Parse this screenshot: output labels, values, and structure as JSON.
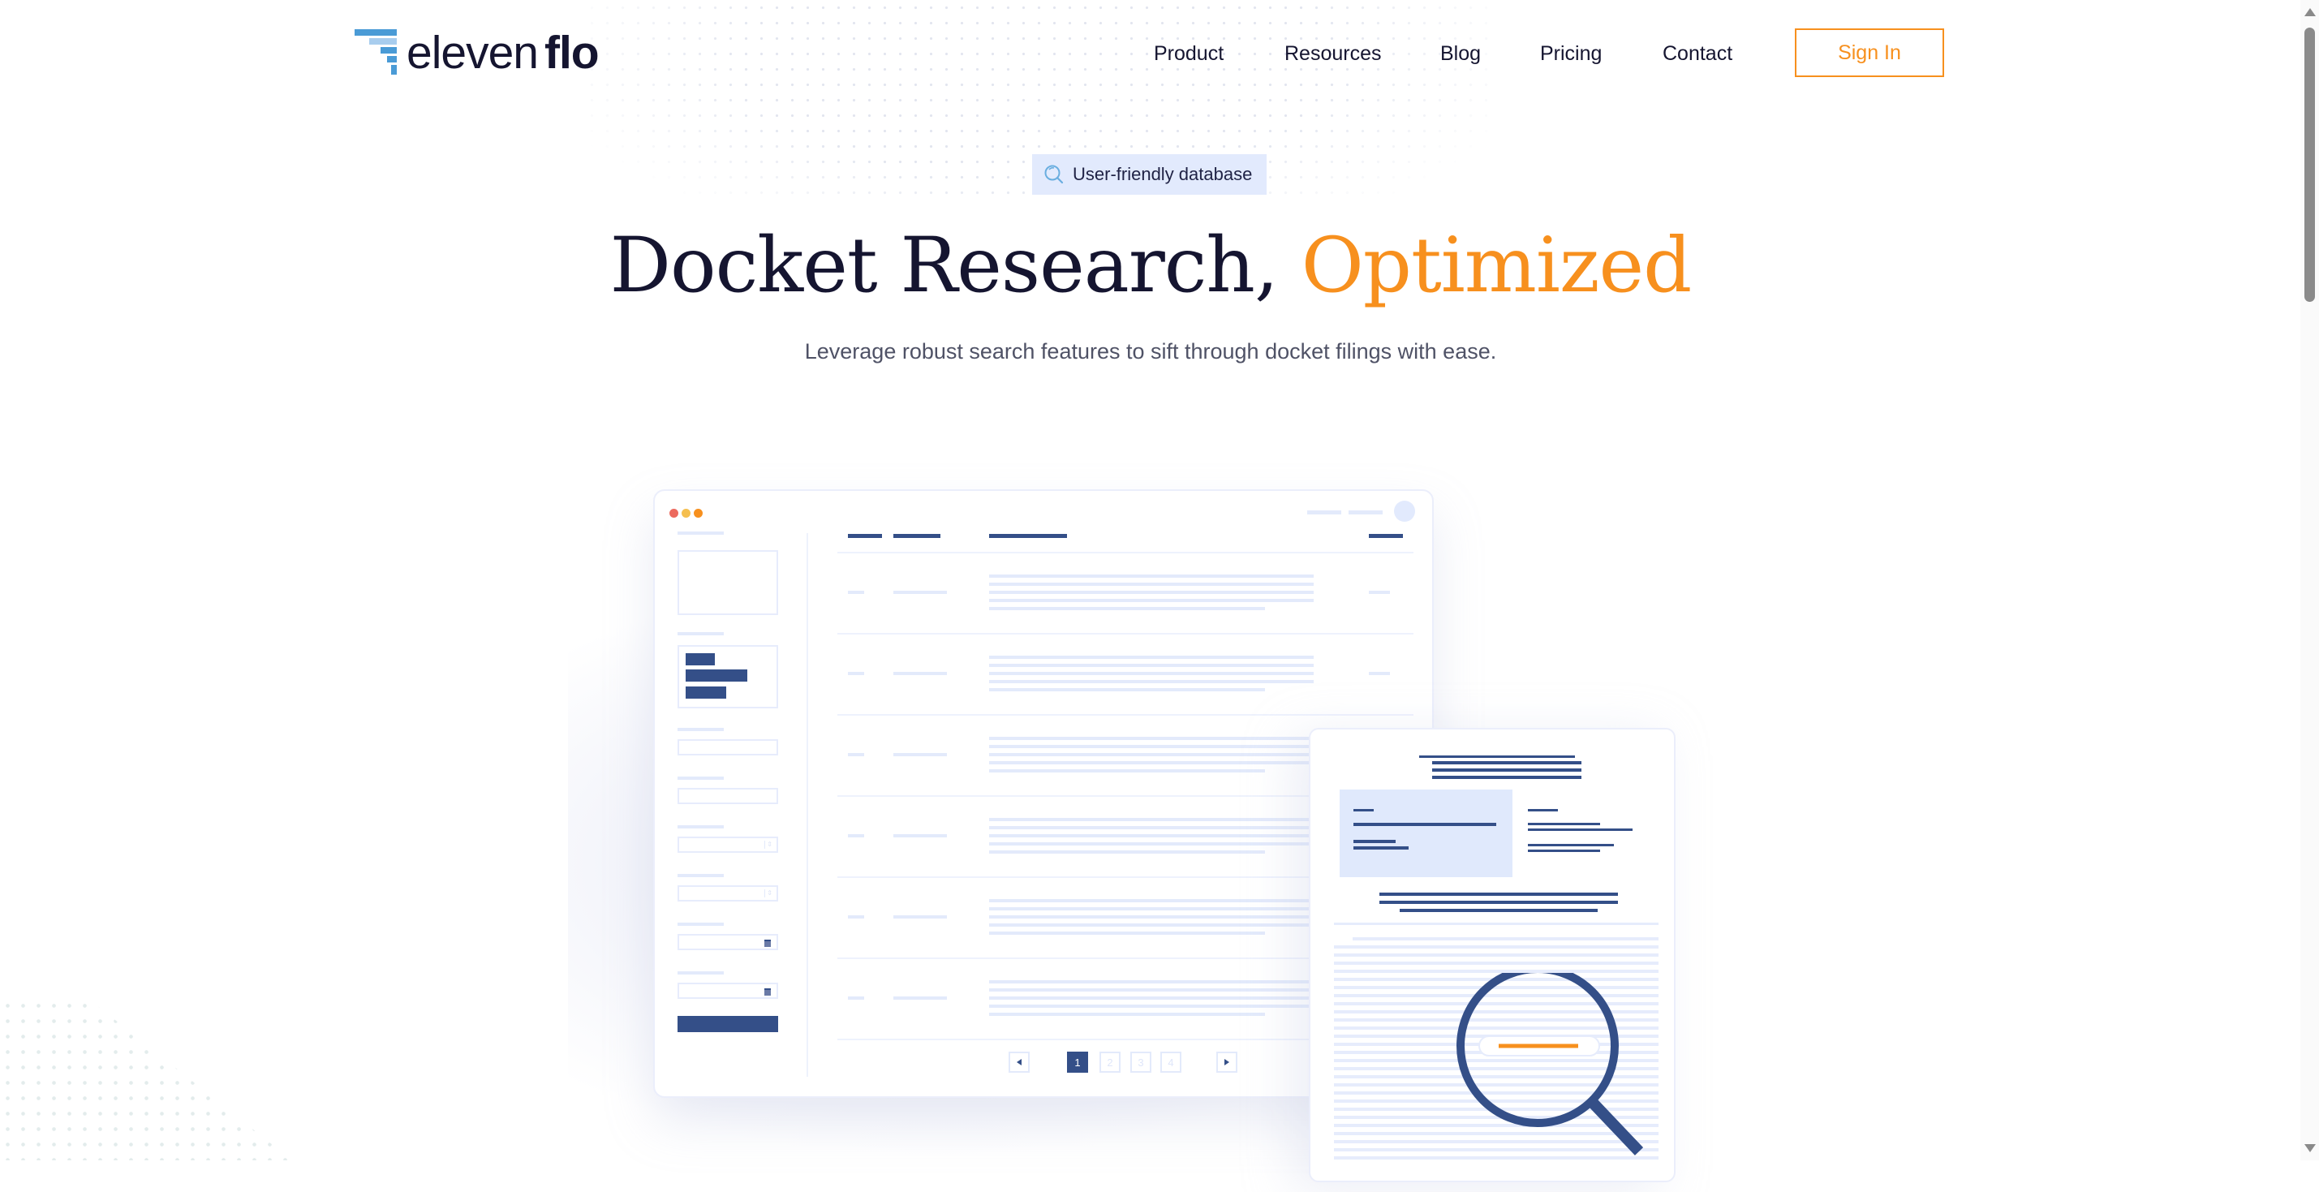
{
  "header": {
    "logo": {
      "light": "eleven",
      "bold": "flo",
      "icon": "stacked-bars-logo-icon"
    },
    "nav": [
      {
        "label": "Product"
      },
      {
        "label": "Resources"
      },
      {
        "label": "Blog"
      },
      {
        "label": "Pricing"
      },
      {
        "label": "Contact"
      }
    ],
    "sign_in_label": "Sign In"
  },
  "hero": {
    "badge": {
      "icon": "search-icon",
      "label": "User-friendly database"
    },
    "title_main": "Docket Research, ",
    "title_accent": "Optimized",
    "subtitle": "Leverage robust search features to sift through docket filings with ease."
  },
  "illustration": {
    "pagination": {
      "prev_icon": "triangle-left-icon",
      "pages": [
        "1",
        "2",
        "3",
        "4"
      ],
      "active_page": "1",
      "next_icon": "triangle-right-icon"
    },
    "magnifier_icon": "magnifying-glass-icon"
  },
  "colors": {
    "accent": "#f7901e",
    "brand_dark": "#151530",
    "illustration_navy": "#344f88",
    "illustration_light": "#e3eafb",
    "badge_bg": "#e2eafd",
    "logo_blue": "#4a9bd6",
    "traffic_red": "#ec6a5e",
    "traffic_yellow": "#f5bf4f",
    "traffic_orange": "#f7901e"
  }
}
